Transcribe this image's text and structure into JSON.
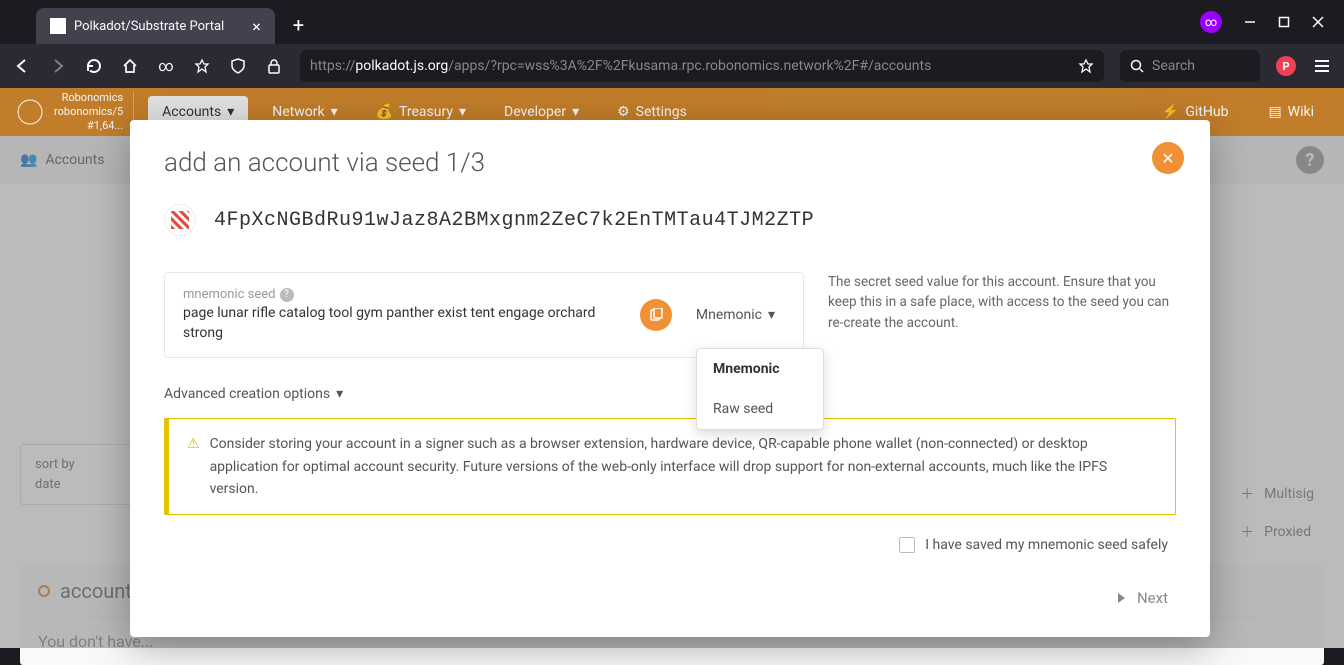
{
  "browser": {
    "tab_title": "Polkadot/Substrate Portal",
    "url_prefix": "https://",
    "url_host": "polkadot.js.org",
    "url_path": "/apps/?rpc=wss%3A%2F%2Fkusama.rpc.robonomics.network%2F#/accounts",
    "search_placeholder": "Search"
  },
  "header": {
    "chain_name": "Robonomics",
    "chain_sub": "robonomics/5",
    "block": "#1,64...",
    "nav": {
      "accounts": "Accounts",
      "network": "Network",
      "treasury": "Treasury",
      "developer": "Developer",
      "settings": "Settings",
      "github": "GitHub",
      "wiki": "Wiki"
    }
  },
  "subbar": {
    "label": "Accounts"
  },
  "page": {
    "sort_label": "sort by",
    "sort_value": "date",
    "multisig": "Multisig",
    "proxied": "Proxied",
    "accounts_heading": "accounts",
    "empty": "You don't have..."
  },
  "modal": {
    "title": "add an account via seed 1/3",
    "address": "4FpXcNGBdRu91wJaz8A2BMxgnm2ZeC7k2EnTMTau4TJM2ZTP",
    "seed_label": "mnemonic seed",
    "seed_value": "page lunar rifle catalog tool gym panther exist tent engage orchard strong",
    "type_selected": "Mnemonic",
    "help": "The secret seed value for this account. Ensure that you keep this in a safe place, with access to the seed you can re-create the account.",
    "advanced": "Advanced creation options",
    "warning": "Consider storing your account in a signer such as a browser extension, hardware device, QR-capable phone wallet (non-connected) or desktop application for optimal account security. Future versions of the web-only interface will drop support for non-external accounts, much like the IPFS version.",
    "confirm": "I have saved my mnemonic seed safely",
    "next": "Next",
    "dropdown": {
      "mnemonic": "Mnemonic",
      "raw": "Raw seed"
    }
  }
}
